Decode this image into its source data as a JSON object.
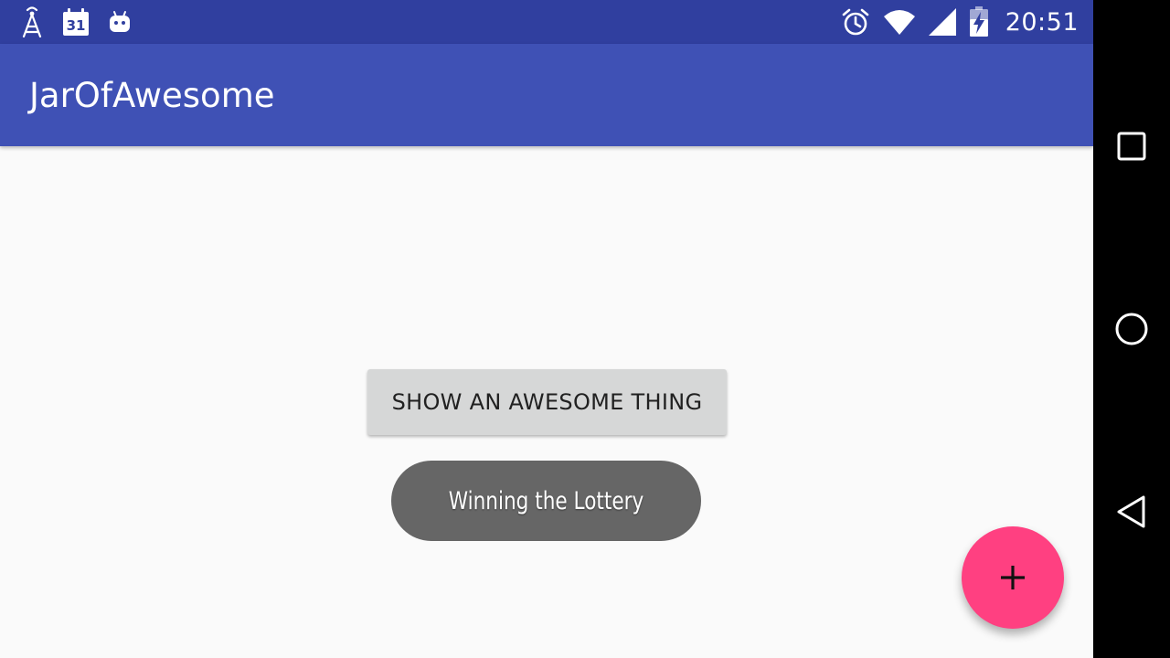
{
  "status_bar": {
    "time": "20:51",
    "calendar_day": "31",
    "left_icons": [
      "signal-tower-icon",
      "calendar-icon",
      "android-icon"
    ],
    "right_icons": [
      "alarm-clock-icon",
      "wifi-icon",
      "cell-signal-icon",
      "battery-charging-icon"
    ]
  },
  "app_bar": {
    "title": "JarOfAwesome"
  },
  "main": {
    "show_button_label": "SHOW AN AWESOME THING",
    "toast_text": "Winning the Lottery"
  },
  "fab": {
    "icon": "plus-icon"
  },
  "nav_bar": {
    "buttons": [
      "recents-square-icon",
      "home-circle-icon",
      "back-triangle-icon"
    ]
  },
  "colors": {
    "status_bar": "#303f9f",
    "app_bar": "#3f51b5",
    "background": "#fafafa",
    "button": "#d6d7d7",
    "toast": "#666666",
    "fab": "#ff4081",
    "nav_bar": "#000000"
  }
}
